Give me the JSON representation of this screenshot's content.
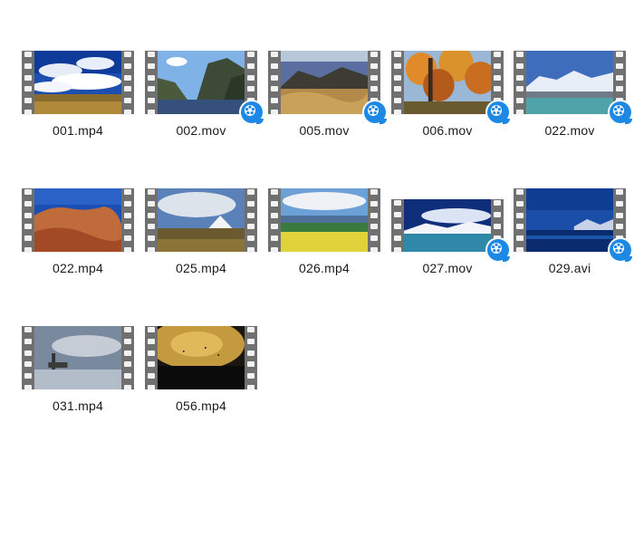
{
  "files": [
    {
      "name": "001.mp4",
      "scene": "sky",
      "badge": false
    },
    {
      "name": "002.mov",
      "scene": "fjord",
      "badge": true
    },
    {
      "name": "005.mov",
      "scene": "grass",
      "badge": true
    },
    {
      "name": "006.mov",
      "scene": "autumn",
      "badge": true
    },
    {
      "name": "022.mov",
      "scene": "lake",
      "badge": true
    },
    {
      "name": "022.mp4",
      "scene": "rock",
      "badge": false
    },
    {
      "name": "025.mp4",
      "scene": "plain",
      "badge": false
    },
    {
      "name": "026.mp4",
      "scene": "field",
      "badge": false
    },
    {
      "name": "027.mov",
      "scene": "lake2",
      "badge": true
    },
    {
      "name": "029.avi",
      "scene": "night",
      "badge": true
    },
    {
      "name": "031.mp4",
      "scene": "pier",
      "badge": false
    },
    {
      "name": "056.mp4",
      "scene": "dusk",
      "badge": false
    }
  ],
  "badge_icon": "quick-player-icon",
  "thumbnail_icon": "video-filmstrip-icon",
  "colors": {
    "badge": "#1e88e5",
    "filmstrip": "#707070",
    "label": "#1a1a1a"
  }
}
